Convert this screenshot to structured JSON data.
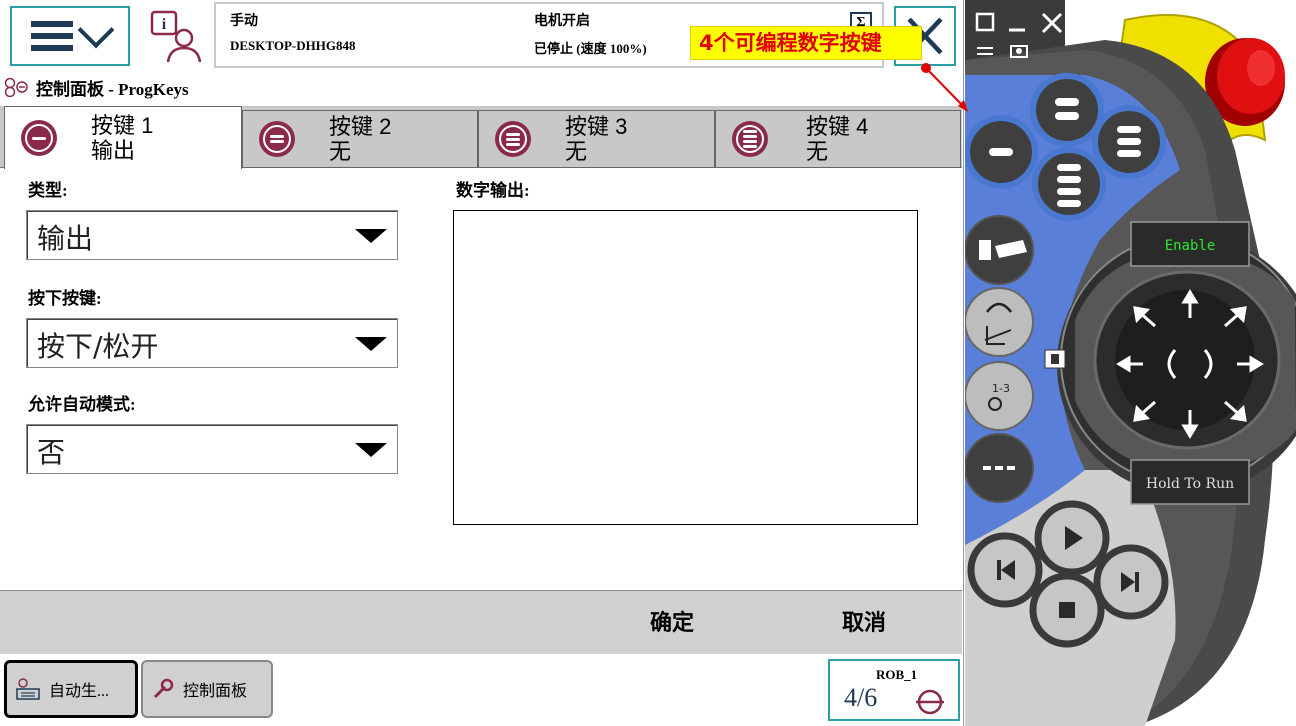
{
  "header": {
    "mode": "手动",
    "system_name": "DESKTOP-DHHG848",
    "motor_status": "电机开启",
    "run_status": "已停止 (速度 100%)"
  },
  "callout": {
    "text": "4个可编程数字按键"
  },
  "title": {
    "text": "控制面板 - ProgKeys"
  },
  "tabs": [
    {
      "line1": "按键 1",
      "line2": "输出",
      "active": true
    },
    {
      "line1": "按键 2",
      "line2": "无",
      "active": false
    },
    {
      "line1": "按键 3",
      "line2": "无",
      "active": false
    },
    {
      "line1": "按键 4",
      "line2": "无",
      "active": false
    }
  ],
  "form": {
    "type_label": "类型:",
    "type_value": "输出",
    "press_label": "按下按键:",
    "press_value": "按下/松开",
    "auto_label": "允许自动模式:",
    "auto_value": "否",
    "digital_label": "数字输出:"
  },
  "footer": {
    "ok": "确定",
    "cancel": "取消"
  },
  "taskbar": {
    "items": [
      {
        "label": "自动生..."
      },
      {
        "label": "控制面板"
      }
    ],
    "rob": {
      "name": "ROB_1",
      "fraction": "4/6"
    }
  },
  "pendant": {
    "enable_label": "Enable",
    "hold_label": "Hold To Run"
  },
  "colors": {
    "accent": "#2a9fa6",
    "tab_icon": "#8b2a48",
    "callout_bg": "#ffff00",
    "callout_text": "#e00000",
    "pendant_blue": "#5a7fd8",
    "pendant_yellow": "#f0e000",
    "estop_red": "#e01010"
  }
}
